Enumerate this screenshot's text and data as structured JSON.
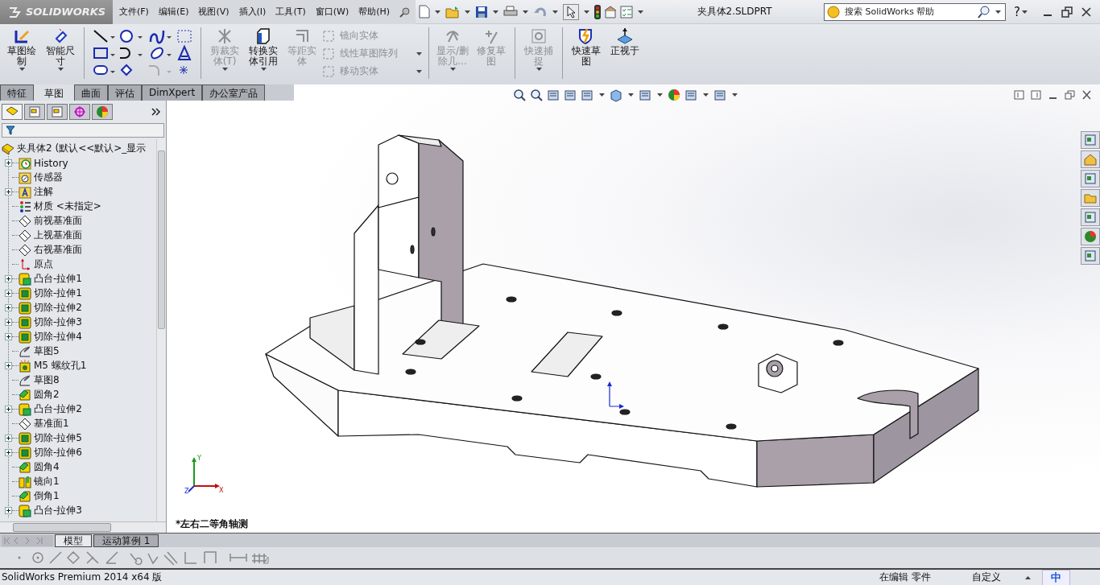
{
  "app": {
    "logo": "SOLIDWORKS",
    "title": "夹具体2.SLDPRT"
  },
  "menu": [
    "文件(F)",
    "编辑(E)",
    "视图(V)",
    "插入(I)",
    "工具(T)",
    "窗口(W)",
    "帮助(H)"
  ],
  "search": {
    "placeholder": "搜索 SolidWorks 帮助"
  },
  "help": "?",
  "command_bar": [
    {
      "kind": "large",
      "label": "草图绘制",
      "disabled": false,
      "dropdown": true
    },
    {
      "kind": "large",
      "label": "智能尺寸",
      "disabled": false,
      "dropdown": true
    },
    {
      "kind": "separator"
    },
    {
      "kind": "grid"
    },
    {
      "kind": "separator"
    },
    {
      "kind": "large",
      "label": "剪裁实体(T)",
      "disabled": true,
      "dropdown": true
    },
    {
      "kind": "large",
      "label": "转换实体引用",
      "disabled": false,
      "dropdown": true
    },
    {
      "kind": "large",
      "label": "等距实体",
      "disabled": true,
      "dropdown": false
    },
    {
      "kind": "list",
      "items": [
        {
          "label": "镜向实体",
          "disabled": true,
          "dropdown": false
        },
        {
          "label": "线性草图阵列",
          "disabled": true,
          "dropdown": true
        },
        {
          "label": "移动实体",
          "disabled": true,
          "dropdown": true
        }
      ]
    },
    {
      "kind": "separator"
    },
    {
      "kind": "large",
      "label": "显示/删除几...",
      "disabled": true,
      "dropdown": true
    },
    {
      "kind": "large",
      "label": "修复草图",
      "disabled": true,
      "dropdown": false
    },
    {
      "kind": "separator"
    },
    {
      "kind": "large",
      "label": "快速捕捉",
      "disabled": true,
      "dropdown": true
    },
    {
      "kind": "separator"
    },
    {
      "kind": "large",
      "label": "快速草图",
      "disabled": false,
      "dropdown": false
    },
    {
      "kind": "large",
      "label": "正视于",
      "disabled": false,
      "dropdown": false
    }
  ],
  "tabs": [
    {
      "label": "特征",
      "selected": false
    },
    {
      "label": "草图",
      "selected": true
    },
    {
      "label": "曲面",
      "selected": false
    },
    {
      "label": "评估",
      "selected": false
    },
    {
      "label": "DimXpert",
      "selected": false
    },
    {
      "label": "办公室产品",
      "selected": false
    }
  ],
  "panel_tabs": [
    {
      "selected": true
    },
    {
      "selected": false
    },
    {
      "selected": false
    },
    {
      "selected": false
    },
    {
      "selected": false
    }
  ],
  "tree": {
    "root": "夹具体2 (默认<<默认>_显示",
    "items": [
      {
        "label": "History",
        "kind": "history",
        "expandable": true
      },
      {
        "label": "传感器",
        "kind": "sensor",
        "expandable": false
      },
      {
        "label": "注解",
        "kind": "annotation",
        "expandable": true
      },
      {
        "label": "材质 <未指定>",
        "kind": "material",
        "expandable": false
      },
      {
        "label": "前视基准面",
        "kind": "plane",
        "expandable": false
      },
      {
        "label": "上视基准面",
        "kind": "plane",
        "expandable": false
      },
      {
        "label": "右视基准面",
        "kind": "plane",
        "expandable": false
      },
      {
        "label": "原点",
        "kind": "origin",
        "expandable": false
      },
      {
        "label": "凸台-拉伸1",
        "kind": "boss",
        "expandable": true
      },
      {
        "label": "切除-拉伸1",
        "kind": "cut",
        "expandable": true
      },
      {
        "label": "切除-拉伸2",
        "kind": "cut",
        "expandable": true
      },
      {
        "label": "切除-拉伸3",
        "kind": "cut",
        "expandable": true
      },
      {
        "label": "切除-拉伸4",
        "kind": "cut",
        "expandable": true
      },
      {
        "label": "草图5",
        "kind": "sketch",
        "expandable": false
      },
      {
        "label": "M5 螺纹孔1",
        "kind": "hole",
        "expandable": true
      },
      {
        "label": "草图8",
        "kind": "sketch",
        "expandable": false
      },
      {
        "label": "圆角2",
        "kind": "fillet",
        "expandable": false
      },
      {
        "label": "凸台-拉伸2",
        "kind": "boss",
        "expandable": true
      },
      {
        "label": "基准面1",
        "kind": "plane",
        "expandable": false
      },
      {
        "label": "切除-拉伸5",
        "kind": "cut",
        "expandable": true
      },
      {
        "label": "切除-拉伸6",
        "kind": "cut",
        "expandable": true
      },
      {
        "label": "圆角4",
        "kind": "fillet",
        "expandable": false
      },
      {
        "label": "镜向1",
        "kind": "mirror",
        "expandable": false
      },
      {
        "label": "倒角1",
        "kind": "fillet",
        "expandable": false
      },
      {
        "label": "凸台-拉伸3",
        "kind": "boss",
        "expandable": true
      }
    ]
  },
  "viewport": {
    "view_label": "*左右二等角轴测",
    "triad": [
      "Y",
      "X",
      "Z"
    ]
  },
  "bottom_tabs": [
    {
      "label": "模型",
      "selected": true
    },
    {
      "label": "运动算例 1",
      "selected": false
    }
  ],
  "status": {
    "product": "SolidWorks Premium 2014 x64 版",
    "mode": "在编辑 零件",
    "units": "自定义"
  },
  "ime": "中"
}
